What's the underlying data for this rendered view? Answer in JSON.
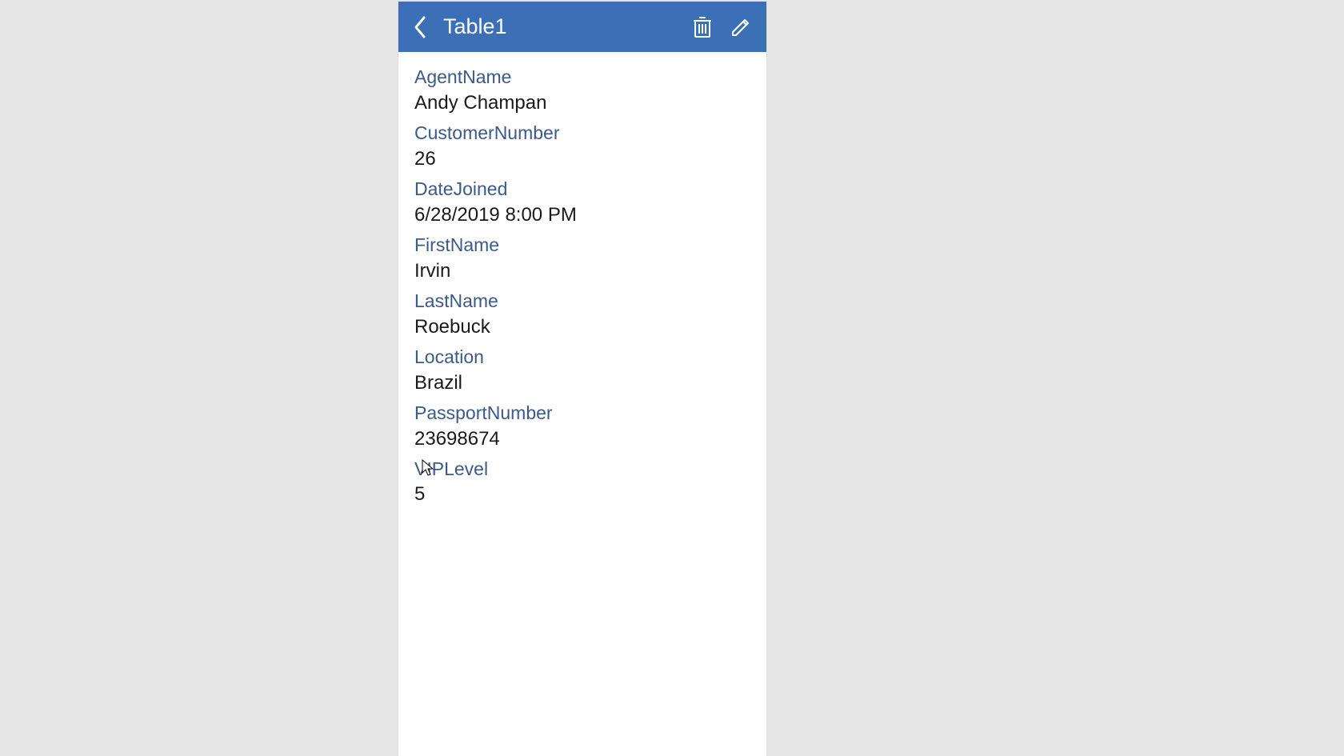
{
  "header": {
    "title": "Table1"
  },
  "fields": [
    {
      "label": "AgentName",
      "value": "Andy Champan"
    },
    {
      "label": "CustomerNumber",
      "value": "26"
    },
    {
      "label": "DateJoined",
      "value": "6/28/2019 8:00 PM"
    },
    {
      "label": "FirstName",
      "value": "Irvin"
    },
    {
      "label": "LastName",
      "value": "Roebuck"
    },
    {
      "label": "Location",
      "value": "Brazil"
    },
    {
      "label": "PassportNumber",
      "value": "23698674"
    },
    {
      "label": "VIPLevel",
      "value": "5"
    }
  ]
}
